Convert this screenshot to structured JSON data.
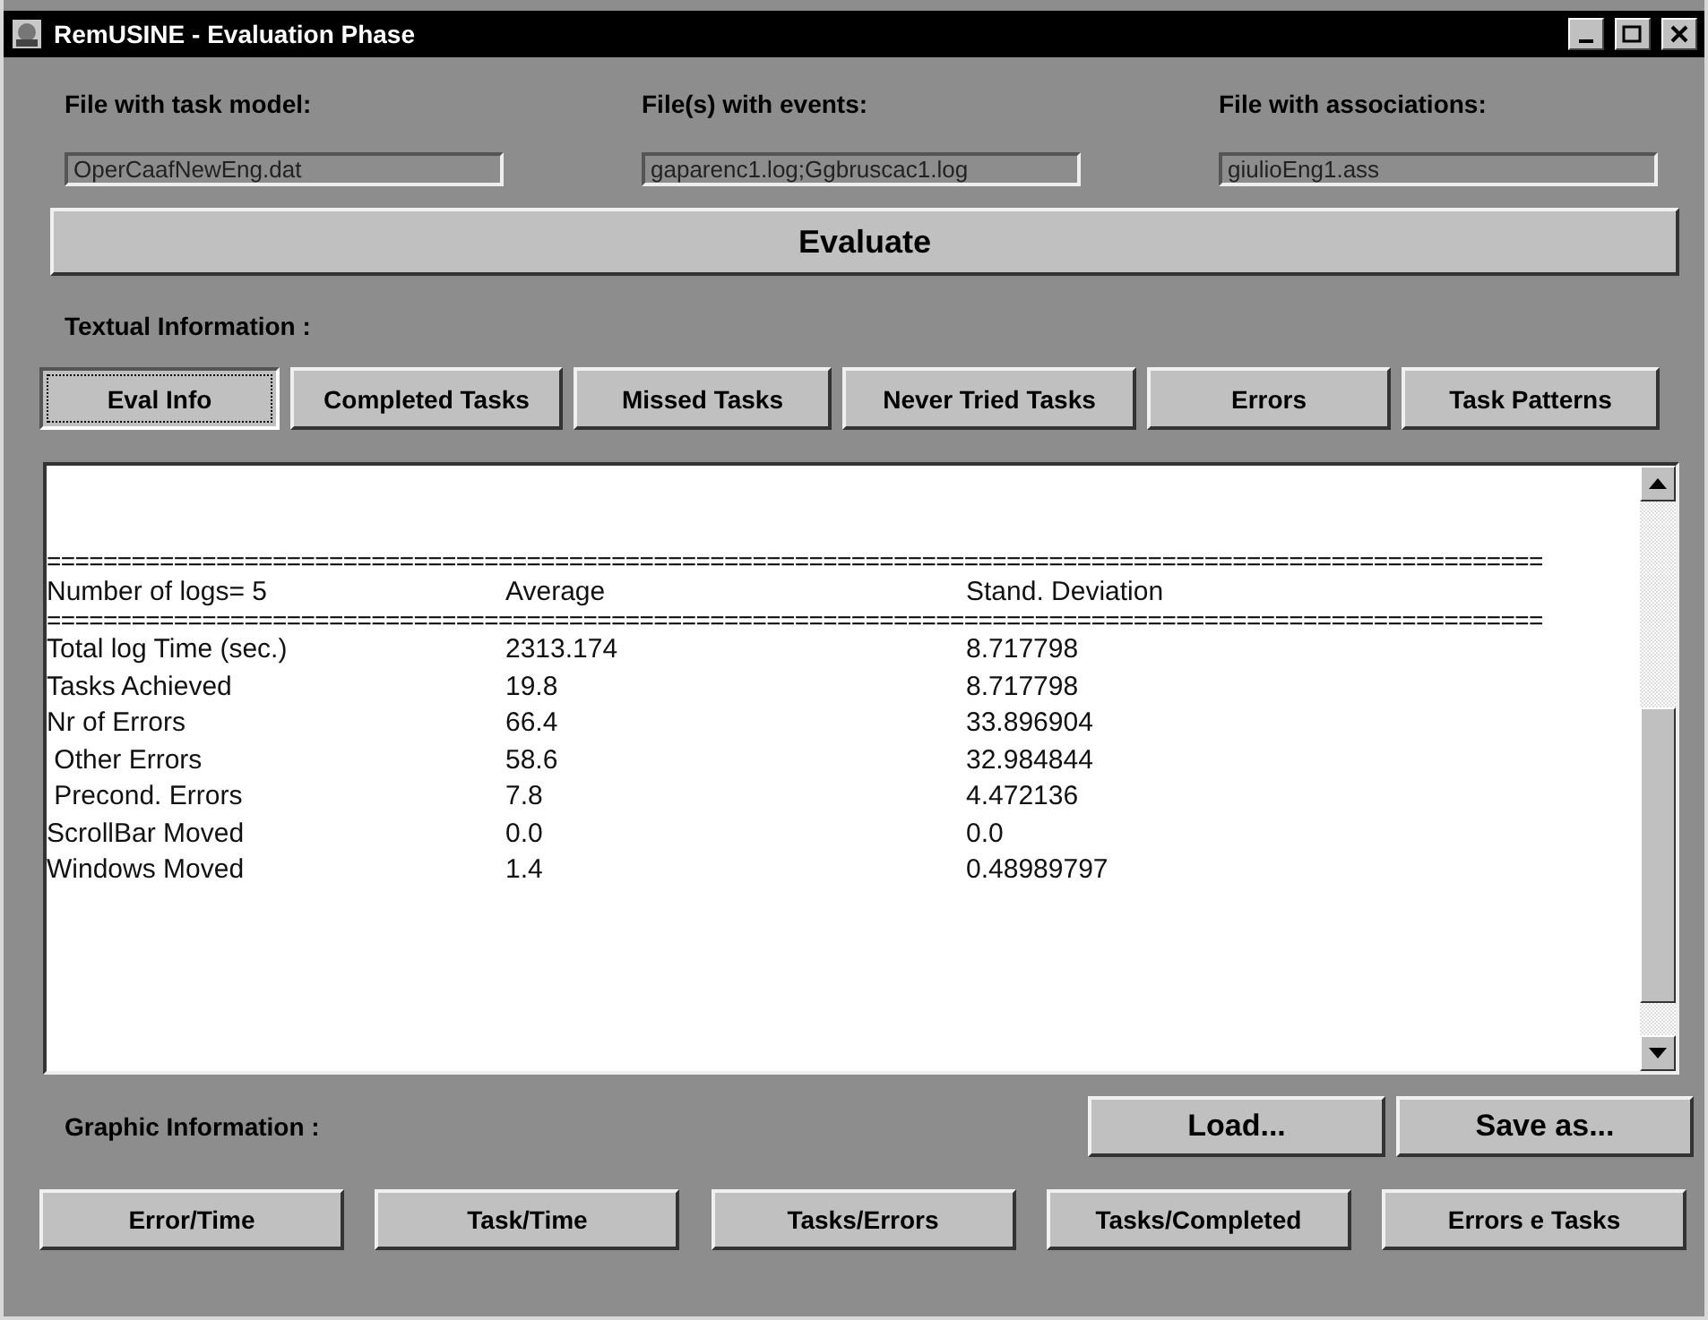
{
  "window": {
    "title": "RemUSINE - Evaluation Phase"
  },
  "files": [
    {
      "label": "File with task model:",
      "value": "OperCaafNewEng.dat"
    },
    {
      "label": "File(s) with events:",
      "value": "gaparenc1.log;Ggbruscac1.log"
    },
    {
      "label": "File with associations:",
      "value": "giulioEng1.ass"
    }
  ],
  "evaluate_button": "Evaluate",
  "textual_heading": "Textual Information :",
  "tabs": [
    {
      "label": "Eval Info",
      "selected": true
    },
    {
      "label": "Completed Tasks",
      "selected": false
    },
    {
      "label": "Missed Tasks",
      "selected": false
    },
    {
      "label": "Never Tried Tasks",
      "selected": false
    },
    {
      "label": "Errors",
      "selected": false
    },
    {
      "label": "Task Patterns",
      "selected": false
    }
  ],
  "report": {
    "separator": "==========================================================================================================",
    "header": [
      "Number of logs= 5",
      "Average",
      "Stand. Deviation"
    ],
    "rows": [
      [
        "Total log Time (sec.)",
        "2313.174",
        "8.717798"
      ],
      [
        "Tasks Achieved",
        "19.8",
        "8.717798"
      ],
      [
        "Nr of Errors",
        "66.4",
        "33.896904"
      ],
      [
        " Other Errors",
        "58.6",
        "32.984844"
      ],
      [
        " Precond. Errors",
        "7.8",
        "4.472136"
      ],
      [
        "ScrollBar Moved",
        "0.0",
        "0.0"
      ],
      [
        "Windows Moved",
        "1.4",
        "0.48989797"
      ]
    ]
  },
  "graphic_heading": "Graphic Information :",
  "file_buttons": [
    "Load...",
    "Save as..."
  ],
  "graph_buttons": [
    "Error/Time",
    "Task/Time",
    "Tasks/Errors",
    "Tasks/Completed",
    "Errors e Tasks"
  ]
}
